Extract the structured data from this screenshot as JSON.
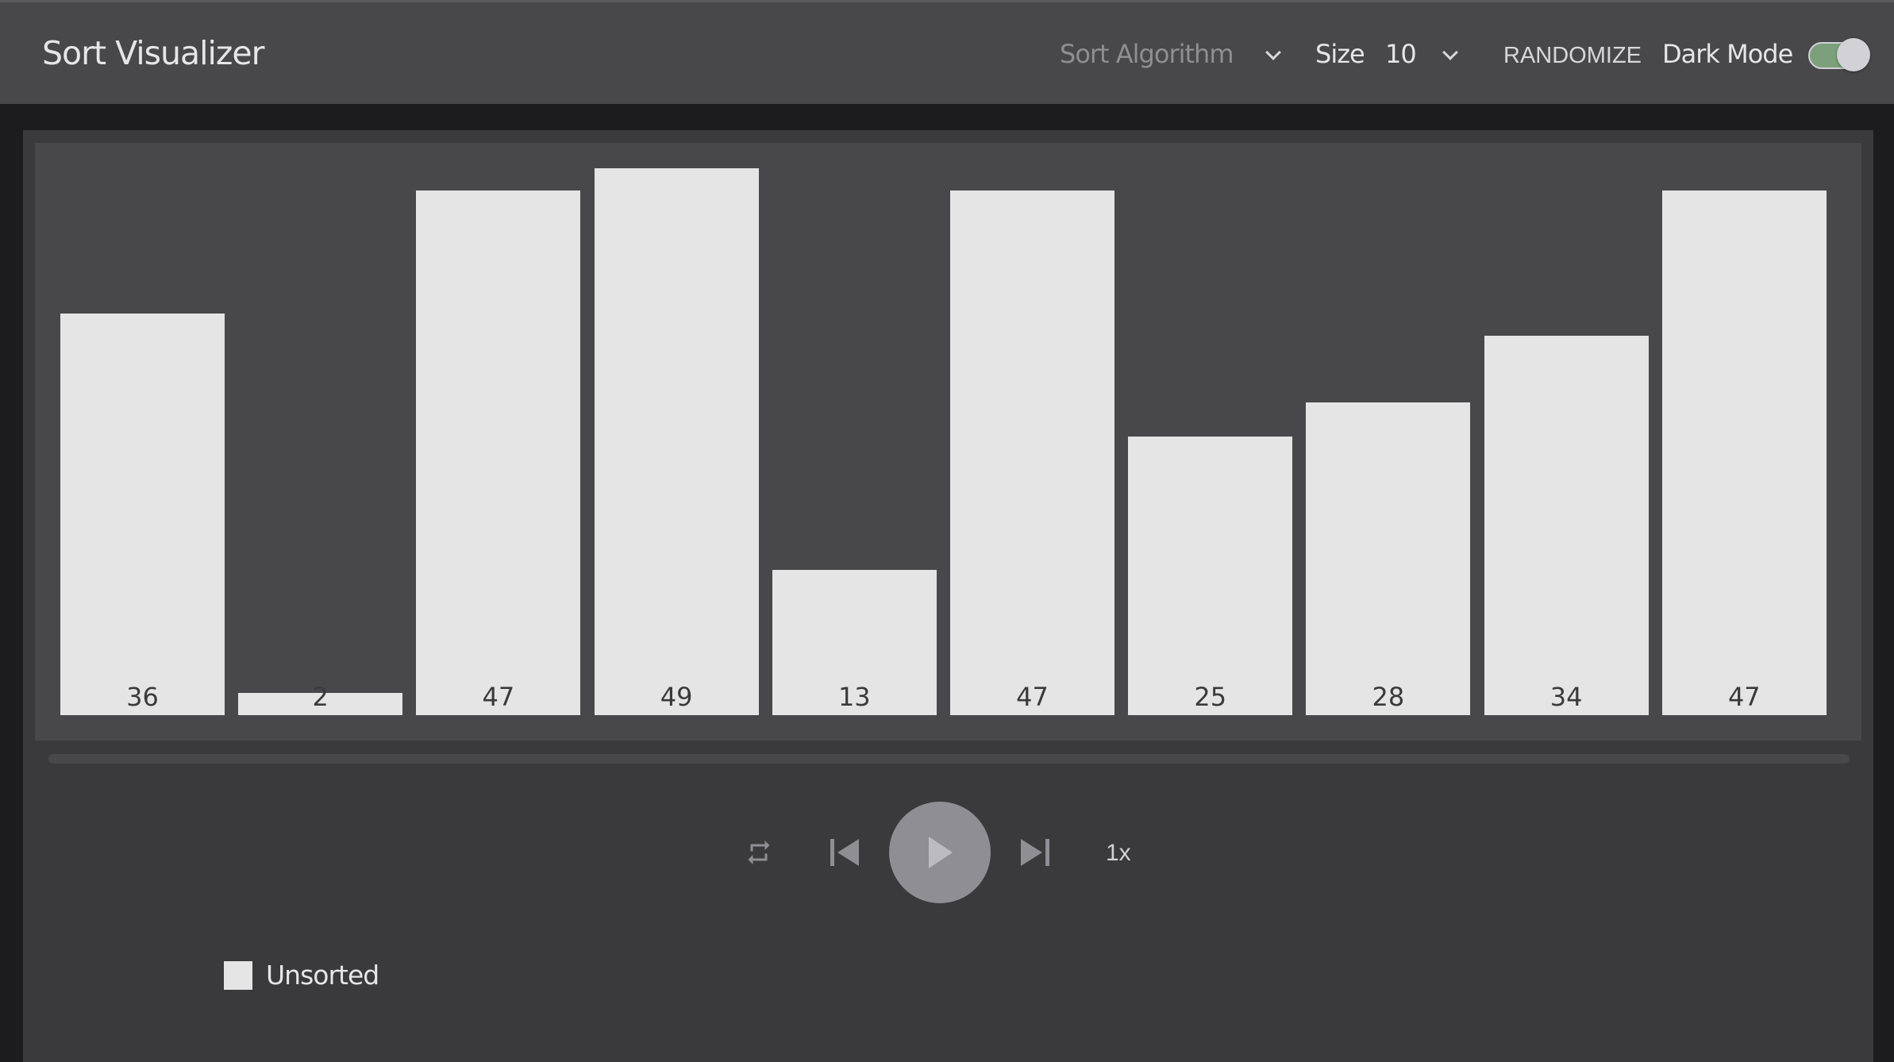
{
  "header": {
    "title": "Sort Visualizer",
    "algorithm_placeholder": "Sort Algorithm",
    "size_label": "Size",
    "size_value": "10",
    "randomize": "RANDOMIZE",
    "dark_mode_label": "Dark Mode",
    "dark_mode_on": true
  },
  "chart_data": {
    "type": "bar",
    "values": [
      36,
      2,
      47,
      49,
      13,
      47,
      25,
      28,
      34,
      47
    ],
    "labels": [
      "36",
      "2",
      "47",
      "49",
      "13",
      "47",
      "25",
      "28",
      "34",
      "47"
    ],
    "bar_color": "#e5e5e5"
  },
  "controls": {
    "speed": "1x",
    "progress": 0
  },
  "legend": {
    "items": [
      {
        "label": "Unsorted",
        "color": "#e5e5e5"
      }
    ]
  },
  "colors": {
    "toggle_on": "#7ca07c",
    "background": "#1c1c1e"
  }
}
